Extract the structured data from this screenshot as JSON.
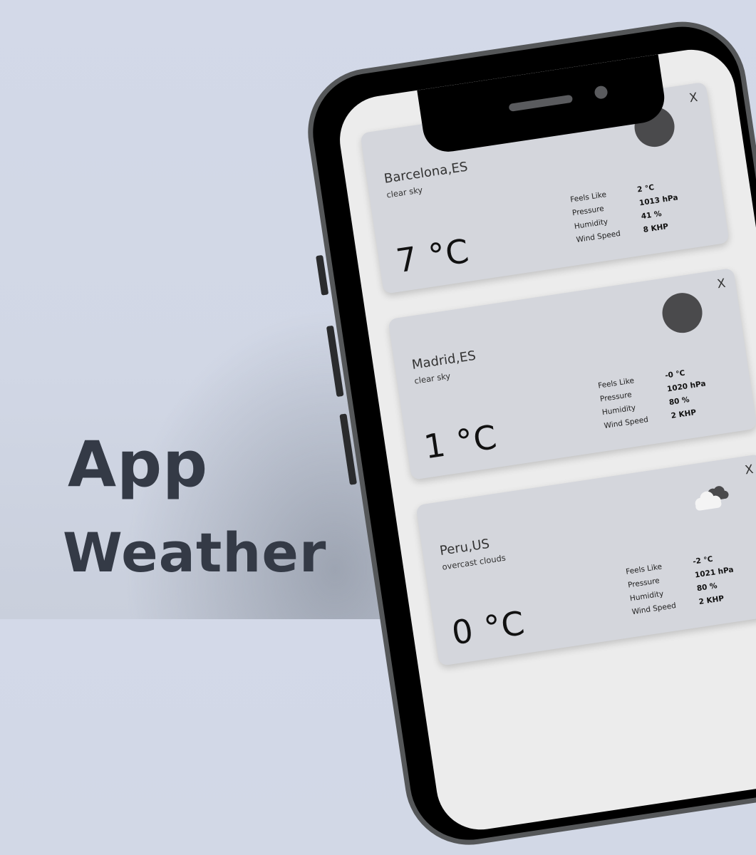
{
  "promo": {
    "line1": "App",
    "line2": "Weather"
  },
  "colors": {
    "background": "#d3d9e8",
    "headline": "#343a46",
    "card": "#d4d6dc",
    "screen": "#ececec",
    "icon": "#4a4a4c"
  },
  "labels": {
    "feels_like": "Feels Like",
    "pressure": "Pressure",
    "humidity": "Humidity",
    "wind_speed": "Wind Speed",
    "close": "X"
  },
  "cards": [
    {
      "city": "Barcelona,ES",
      "description": "clear sky",
      "temperature": "7 °C",
      "icon": "sun-icon",
      "feels_like": "2 °C",
      "pressure": "1013 hPa",
      "humidity": "41 %",
      "wind_speed": "8 KHP"
    },
    {
      "city": "Madrid,ES",
      "description": "clear sky",
      "temperature": "1 °C",
      "icon": "sun-icon",
      "feels_like": "-0 °C",
      "pressure": "1020 hPa",
      "humidity": "80 %",
      "wind_speed": "2 KHP"
    },
    {
      "city": "Peru,US",
      "description": "overcast clouds",
      "temperature": "0 °C",
      "icon": "clouds-icon",
      "feels_like": "-2 °C",
      "pressure": "1021 hPa",
      "humidity": "80 %",
      "wind_speed": "2 KHP"
    }
  ]
}
